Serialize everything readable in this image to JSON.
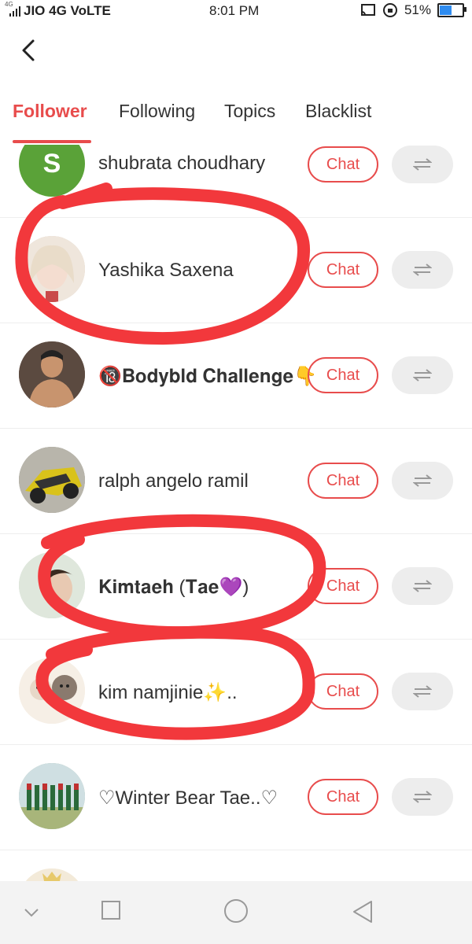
{
  "status_bar": {
    "network_tag": "4G",
    "carrier": "JIO 4G VoLTE",
    "time": "8:01 PM",
    "battery": "51%",
    "battery_level": 0.51
  },
  "tabs": [
    {
      "label": "Follower",
      "active": true
    },
    {
      "label": "Following",
      "active": false
    },
    {
      "label": "Topics",
      "active": false
    },
    {
      "label": "Blacklist",
      "active": false
    }
  ],
  "followers": [
    {
      "name": "shubrata choudhary",
      "avatar_letter": "S",
      "avatar_color": "#5aa238"
    },
    {
      "name": "Yashika Saxena",
      "avatar_letter": "",
      "avatar_color": "#d9c7b8"
    },
    {
      "name": "🔞𝐁𝐨𝐝𝐲𝐛𝐥𝐝 𝐂𝐡𝐚𝐥𝐥𝐞𝐧𝐠𝐞👇",
      "avatar_letter": "",
      "avatar_color": "#6d5446"
    },
    {
      "name": "ralph angelo ramil",
      "avatar_letter": "",
      "avatar_color": "#8a8a7a"
    },
    {
      "name": "𝐊𝐢𝐦𝐭𝐚𝐞𝐡 (𝐓𝐚𝐞💜)",
      "avatar_letter": "",
      "avatar_color": "#c9d8c8"
    },
    {
      "name": "kim namjinie✨..",
      "avatar_letter": "",
      "avatar_color": "#f4ece1"
    },
    {
      "name": "♡Winter Bear Tae..♡",
      "avatar_letter": "",
      "avatar_color": "#9bb4a2"
    },
    {
      "name": "",
      "avatar_letter": "",
      "avatar_color": "#f3ead9"
    }
  ],
  "chat_label": "Chat",
  "colors": {
    "accent": "#e84c4c",
    "annotation": "#f2383c",
    "button_bg": "#ededed"
  },
  "icons": {
    "back": "chevron-left-icon",
    "swap": "swap-arrows-icon",
    "nav": [
      "chevron-down-icon",
      "square-icon",
      "circle-icon",
      "triangle-back-icon"
    ]
  }
}
